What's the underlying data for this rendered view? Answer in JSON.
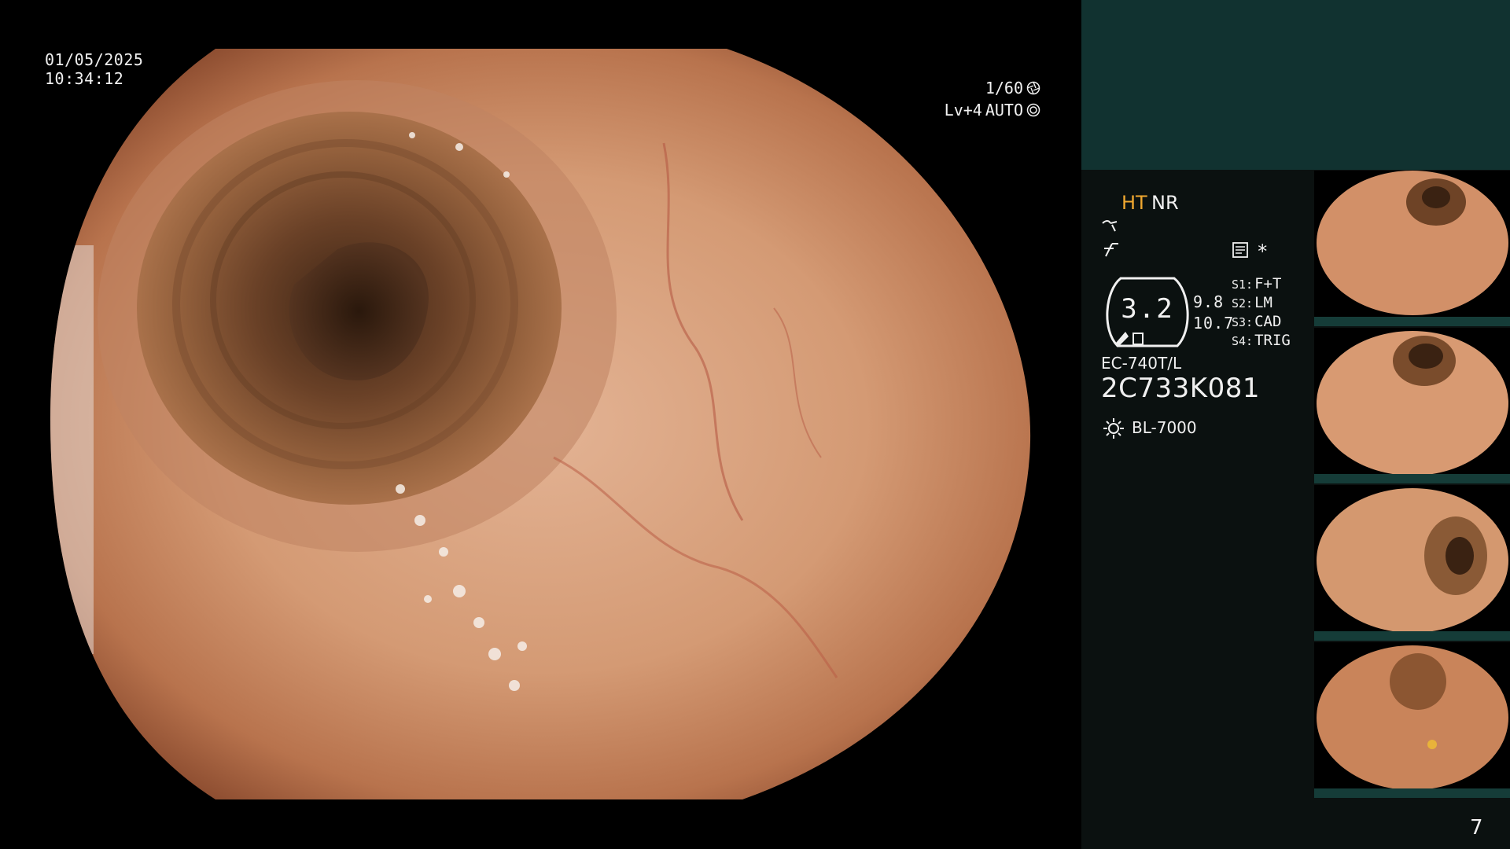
{
  "overlay": {
    "date": "01/05/2025",
    "time": "10:34:12",
    "shutter": "1/60",
    "level": "Lv+4",
    "iris": "AUTO"
  },
  "panel": {
    "ht_label": "HT",
    "nr_label": "NR",
    "asterisk": "*",
    "gauge_value": "3.2",
    "gauge_right_1": "9.8",
    "gauge_right_2": "10.7",
    "slots": [
      {
        "key": "S1:",
        "value": "F+T"
      },
      {
        "key": "S2:",
        "value": "LM"
      },
      {
        "key": "S3:",
        "value": "CAD"
      },
      {
        "key": "S4:",
        "value": "TRIG"
      }
    ],
    "scope_model": "EC-740T/L",
    "scope_serial": "2C733K081",
    "light_source": "BL-7000",
    "page_number": "7"
  },
  "icons": {
    "shutter_icon": "aperture-icon",
    "iris_icon": "iris-icon",
    "structure_icon": "structure-enhance-icon",
    "contrast_icon": "contrast-icon",
    "memo_icon": "memo-icon",
    "light_icon": "light-source-icon"
  },
  "colors": {
    "panel_header": "#113230",
    "panel_body": "#0b1110",
    "ht_accent": "#f0a830",
    "mucosa": "#c98a62"
  }
}
